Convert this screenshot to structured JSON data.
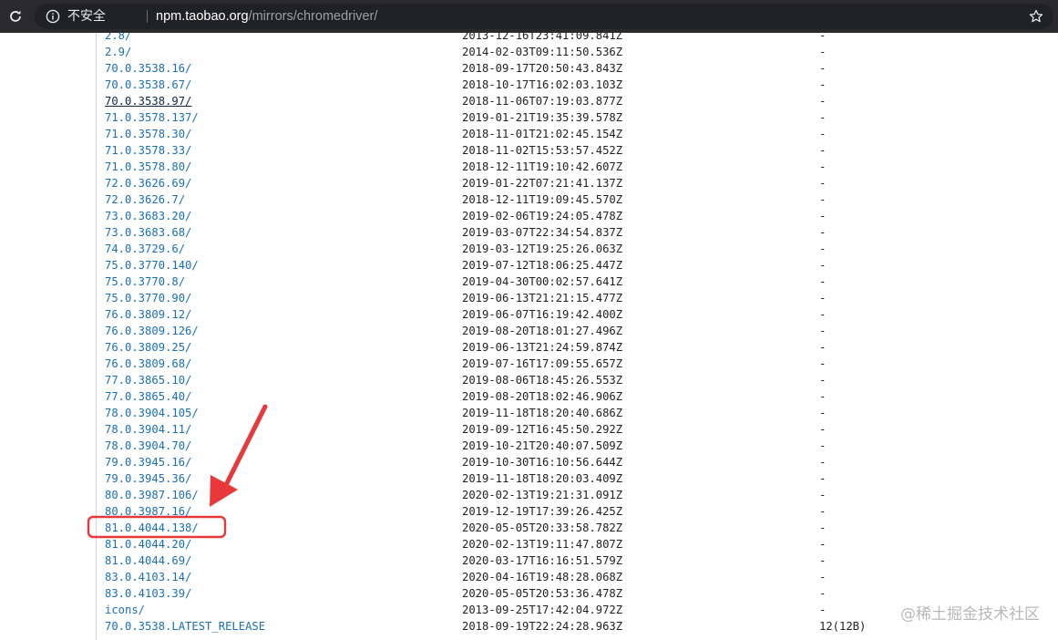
{
  "browser": {
    "security_label": "不安全",
    "url_host": "npm.taobao.org",
    "url_path": "/mirrors/chromedriver/"
  },
  "listing": {
    "rows": [
      {
        "name": "2.8/",
        "date": "2013-12-16T23:41:09.841Z",
        "size": "-"
      },
      {
        "name": "2.9/",
        "date": "2014-02-03T09:11:50.536Z",
        "size": "-"
      },
      {
        "name": "70.0.3538.16/",
        "date": "2018-09-17T20:50:43.843Z",
        "size": "-"
      },
      {
        "name": "70.0.3538.67/",
        "date": "2018-10-17T16:02:03.103Z",
        "size": "-"
      },
      {
        "name": "70.0.3538.97/",
        "date": "2018-11-06T07:19:03.877Z",
        "size": "-"
      },
      {
        "name": "71.0.3578.137/",
        "date": "2019-01-21T19:35:39.578Z",
        "size": "-"
      },
      {
        "name": "71.0.3578.30/",
        "date": "2018-11-01T21:02:45.154Z",
        "size": "-"
      },
      {
        "name": "71.0.3578.33/",
        "date": "2018-11-02T15:53:57.452Z",
        "size": "-"
      },
      {
        "name": "71.0.3578.80/",
        "date": "2018-12-11T19:10:42.607Z",
        "size": "-"
      },
      {
        "name": "72.0.3626.69/",
        "date": "2019-01-22T07:21:41.137Z",
        "size": "-"
      },
      {
        "name": "72.0.3626.7/",
        "date": "2018-12-11T19:09:45.570Z",
        "size": "-"
      },
      {
        "name": "73.0.3683.20/",
        "date": "2019-02-06T19:24:05.478Z",
        "size": "-"
      },
      {
        "name": "73.0.3683.68/",
        "date": "2019-03-07T22:34:54.837Z",
        "size": "-"
      },
      {
        "name": "74.0.3729.6/",
        "date": "2019-03-12T19:25:26.063Z",
        "size": "-"
      },
      {
        "name": "75.0.3770.140/",
        "date": "2019-07-12T18:06:25.447Z",
        "size": "-"
      },
      {
        "name": "75.0.3770.8/",
        "date": "2019-04-30T00:02:57.641Z",
        "size": "-"
      },
      {
        "name": "75.0.3770.90/",
        "date": "2019-06-13T21:21:15.477Z",
        "size": "-"
      },
      {
        "name": "76.0.3809.12/",
        "date": "2019-06-07T16:19:42.400Z",
        "size": "-"
      },
      {
        "name": "76.0.3809.126/",
        "date": "2019-08-20T18:01:27.496Z",
        "size": "-"
      },
      {
        "name": "76.0.3809.25/",
        "date": "2019-06-13T21:24:59.874Z",
        "size": "-"
      },
      {
        "name": "76.0.3809.68/",
        "date": "2019-07-16T17:09:55.657Z",
        "size": "-"
      },
      {
        "name": "77.0.3865.10/",
        "date": "2019-08-06T18:45:26.553Z",
        "size": "-"
      },
      {
        "name": "77.0.3865.40/",
        "date": "2019-08-20T18:02:46.906Z",
        "size": "-"
      },
      {
        "name": "78.0.3904.105/",
        "date": "2019-11-18T18:20:40.686Z",
        "size": "-"
      },
      {
        "name": "78.0.3904.11/",
        "date": "2019-09-12T16:45:50.292Z",
        "size": "-"
      },
      {
        "name": "78.0.3904.70/",
        "date": "2019-10-21T20:40:07.509Z",
        "size": "-"
      },
      {
        "name": "79.0.3945.16/",
        "date": "2019-10-30T16:10:56.644Z",
        "size": "-"
      },
      {
        "name": "79.0.3945.36/",
        "date": "2019-11-18T18:20:03.409Z",
        "size": "-"
      },
      {
        "name": "80.0.3987.106/",
        "date": "2020-02-13T19:21:31.091Z",
        "size": "-"
      },
      {
        "name": "80.0.3987.16/",
        "date": "2019-12-19T17:39:26.425Z",
        "size": "-"
      },
      {
        "name": "81.0.4044.138/",
        "date": "2020-05-05T20:33:58.782Z",
        "size": "-"
      },
      {
        "name": "81.0.4044.20/",
        "date": "2020-02-13T19:11:47.807Z",
        "size": "-"
      },
      {
        "name": "81.0.4044.69/",
        "date": "2020-03-17T16:16:51.579Z",
        "size": "-"
      },
      {
        "name": "83.0.4103.14/",
        "date": "2020-04-16T19:48:28.068Z",
        "size": "-"
      },
      {
        "name": "83.0.4103.39/",
        "date": "2020-05-05T20:53:36.478Z",
        "size": "-"
      },
      {
        "name": "icons/",
        "date": "2013-09-25T17:42:04.972Z",
        "size": "-"
      },
      {
        "name": "70.0.3538.LATEST_RELEASE",
        "date": "2018-09-19T22:24:28.963Z",
        "size": "12(12B)"
      }
    ]
  },
  "annotation": {
    "highlighted_item": "81.0.4044.138/",
    "accent_color": "#e8383a"
  },
  "watermark": {
    "text": "@稀土掘金技术社区"
  }
}
